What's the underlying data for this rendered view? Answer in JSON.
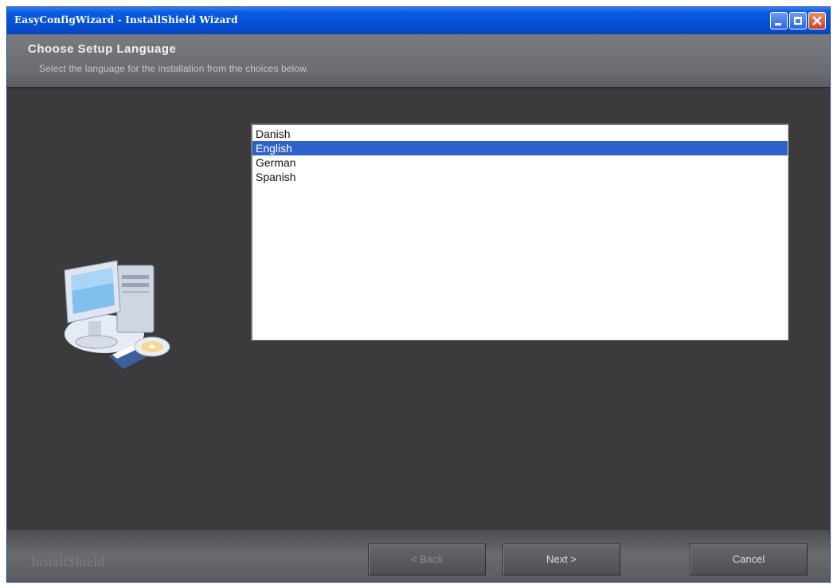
{
  "window": {
    "title": "EasyConfigWizard - InstallShield Wizard"
  },
  "header": {
    "title": "Choose Setup Language",
    "subtitle": "Select the language for the installation from the choices below."
  },
  "language_list": {
    "items": [
      "Danish",
      "English",
      "German",
      "Spanish"
    ],
    "selected": "English"
  },
  "footer": {
    "brand": "InstallShield",
    "back_label": "< Back",
    "next_label": "Next >",
    "cancel_label": "Cancel"
  },
  "colors": {
    "titlebar": "#0650d6",
    "selection": "#2e62c9",
    "body": "#3b3b3d"
  }
}
